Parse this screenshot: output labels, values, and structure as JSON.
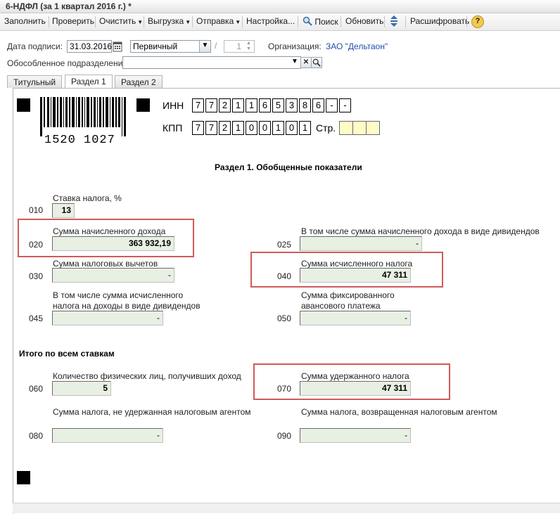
{
  "window": {
    "title": "6-НДФЛ (за 1 квартал 2016 г.) *"
  },
  "toolbar": {
    "fill": "Заполнить",
    "check": "Проверить",
    "clear": "Очистить",
    "upload": "Выгрузка",
    "send": "Отправка",
    "settings": "Настройка...",
    "search": "Поиск",
    "refresh": "Обновить",
    "decode": "Расшифровать",
    "help": "?"
  },
  "header": {
    "sign_date_label": "Дата подписи:",
    "sign_date": "31.03.2016",
    "doc_type": "Первичный",
    "slash": "/",
    "correction_num": "1",
    "org_label": "Организация:",
    "org_value": "ЗАО \"Дельтаон\"",
    "division_label": "Обособленное подразделение:",
    "division_value": ""
  },
  "tabs": [
    "Титульный",
    "Раздел 1",
    "Раздел 2"
  ],
  "form": {
    "barcode_number": "1520 1027",
    "inn_label": "ИНН",
    "inn_cells": [
      "7",
      "7",
      "2",
      "1",
      "1",
      "6",
      "5",
      "3",
      "8",
      "6",
      "-",
      "-"
    ],
    "kpp_label": "КПП",
    "kpp_cells": [
      "7",
      "7",
      "2",
      "1",
      "0",
      "0",
      "1",
      "0",
      "1"
    ],
    "page_label": "Стр.",
    "section_title": "Раздел 1. Обобщенные показатели",
    "totals_title": "Итого по всем ставкам",
    "fields": {
      "f010": {
        "code": "010",
        "label": "Ставка налога, %",
        "value": "13"
      },
      "f020": {
        "code": "020",
        "label": "Сумма начисленного дохода",
        "value": "363 932,19"
      },
      "f025": {
        "code": "025",
        "label": "В том числе сумма начисленного дохода в виде дивидендов",
        "value": "-"
      },
      "f030": {
        "code": "030",
        "label": "Сумма налоговых вычетов",
        "value": "-"
      },
      "f040": {
        "code": "040",
        "label": "Сумма исчисленного налога",
        "value": "47 311"
      },
      "f045": {
        "code": "045",
        "label1": "В том числе сумма исчисленного",
        "label2": "налога на доходы в виде дивидендов",
        "value": "-"
      },
      "f050": {
        "code": "050",
        "label1": "Сумма фиксированного",
        "label2": "авансового платежа",
        "value": "-"
      },
      "f060": {
        "code": "060",
        "label": "Количество физических лиц, получивших доход",
        "value": "5"
      },
      "f070": {
        "code": "070",
        "label": "Сумма удержанного налога",
        "value": "47 311"
      },
      "f080": {
        "code": "080",
        "label": "Сумма налога, не удержанная налоговым агентом",
        "value": "-"
      },
      "f090": {
        "code": "090",
        "label": "Сумма налога, возвращенная налоговым агентом",
        "value": "-"
      }
    }
  },
  "colors": {
    "highlight": "#d05a5a",
    "input_bg": "#e8f0e3",
    "page_cell_bg": "#fffbc8",
    "link": "#1f4fa8"
  }
}
